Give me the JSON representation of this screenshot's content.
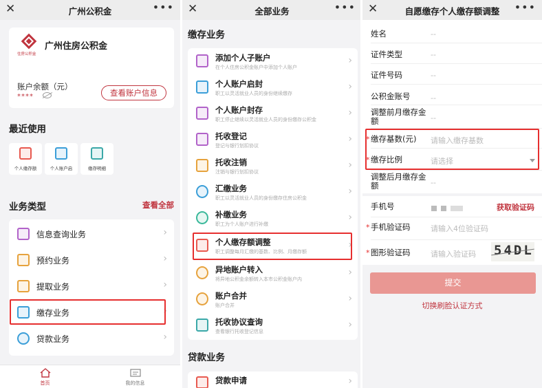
{
  "panel1": {
    "nav": {
      "close": "✕",
      "title": "广州公积金",
      "more": "•••"
    },
    "account": {
      "org_name": "广州住房公积金",
      "logo_text": "住房公积金",
      "balance_label": "账户余额（元）",
      "balance_value": "****",
      "view_button": "查看账户信息"
    },
    "recent_title": "最近使用",
    "recent": [
      {
        "label": "个人缴存额",
        "icon": "money-icon",
        "color": "#e8594f"
      },
      {
        "label": "个人账户启",
        "icon": "folder-icon",
        "color": "#3a9ed8"
      },
      {
        "label": "缴存明细",
        "icon": "list-icon",
        "color": "#3aa8a8"
      }
    ],
    "biz_title": "业务类型",
    "view_all": "查看全部",
    "biz": [
      {
        "label": "信息查询业务",
        "icon": "search-doc-icon",
        "color": "#b162c9"
      },
      {
        "label": "预约业务",
        "icon": "calendar-icon",
        "color": "#e6a23c"
      },
      {
        "label": "提取业务",
        "icon": "wallet-icon",
        "color": "#e6a23c"
      },
      {
        "label": "缴存业务",
        "icon": "deposit-icon",
        "color": "#3a9ed8"
      },
      {
        "label": "贷款业务",
        "icon": "loan-icon",
        "color": "#3a9ed8"
      }
    ],
    "tabs": [
      {
        "label": "首页",
        "icon": "home-icon"
      },
      {
        "label": "我的信息",
        "icon": "profile-card-icon"
      }
    ]
  },
  "panel2": {
    "nav": {
      "close": "✕",
      "title": "全部业务",
      "more": "•••"
    },
    "section_title": "缴存业务",
    "services": [
      {
        "title": "添加个人子账户",
        "desc": "在个人住房公积金账户中添加个人账户",
        "icon": "add-user-icon",
        "color": "#b162c9"
      },
      {
        "title": "个人账户启封",
        "desc": "职工以灵活就业人员的身份继续缴存",
        "icon": "folder-icon",
        "color": "#3a9ed8"
      },
      {
        "title": "个人账户封存",
        "desc": "职工停止继续以灵活就业人员的身份缴存公积金",
        "icon": "lock-user-icon",
        "color": "#b162c9"
      },
      {
        "title": "托收登记",
        "desc": "登记与银行划扣协议",
        "icon": "register-icon",
        "color": "#b162c9"
      },
      {
        "title": "托收注销",
        "desc": "注销与银行划扣协议",
        "icon": "cancel-doc-icon",
        "color": "#e6a23c"
      },
      {
        "title": "汇缴业务",
        "desc": "职工以灵活就业人员的身份缴存住房公积金",
        "icon": "yen-icon",
        "color": "#3a9ed8"
      },
      {
        "title": "补缴业务",
        "desc": "职工为个人账户进行补缴",
        "icon": "yen-icon",
        "color": "#3ab89a"
      },
      {
        "title": "个人缴存额调整",
        "desc": "职工调整每月汇缴的基数、比例、月缴存额",
        "icon": "money-icon",
        "color": "#e8594f"
      },
      {
        "title": "异地账户转入",
        "desc": "将异地公积金余额转入本市公积金账户内",
        "icon": "transfer-icon",
        "color": "#e6a23c"
      },
      {
        "title": "账户合并",
        "desc": "账户合并",
        "icon": "merge-icon",
        "color": "#e6a23c"
      },
      {
        "title": "托收协议查询",
        "desc": "查看银行托收登记信息",
        "icon": "query-doc-icon",
        "color": "#3aa8a8"
      }
    ],
    "loan_title": "贷款业务",
    "loan_first": "贷款申请"
  },
  "panel3": {
    "nav": {
      "close": "✕",
      "title": "自愿缴存个人缴存额调整",
      "more": "•••"
    },
    "fields": [
      {
        "label": "姓名",
        "value": "--"
      },
      {
        "label": "证件类型",
        "value": "--"
      },
      {
        "label": "证件号码",
        "value": "--"
      },
      {
        "label": "公积金账号",
        "value": "--"
      },
      {
        "label": "调整前月缴存金额",
        "value": "--"
      },
      {
        "label": "缴存基数(元)",
        "value": "请输入缴存基数"
      },
      {
        "label": "缴存比例",
        "value": "请选择"
      },
      {
        "label": "调整后月缴存金额",
        "value": "--"
      }
    ],
    "phone_label": "手机号",
    "get_code": "获取验证码",
    "sms_label": "手机验证码",
    "sms_placeholder": "请输入4位验证码",
    "captcha_label": "图形验证码",
    "captcha_placeholder": "请输入验证码",
    "captcha_text": "54DL",
    "submit": "提交",
    "switch": "切换刷脸认证方式"
  }
}
